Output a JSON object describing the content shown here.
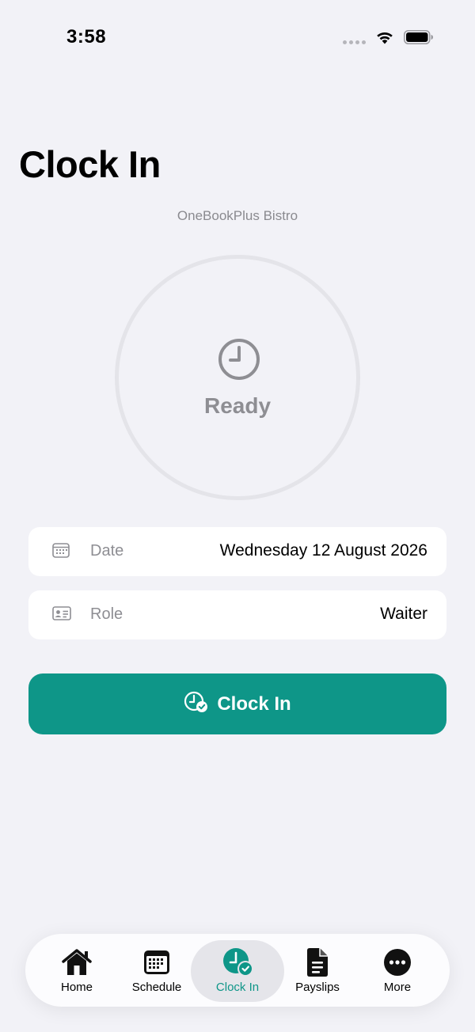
{
  "status_bar": {
    "time": "3:58",
    "icons": [
      "cellular-dots-icon",
      "wifi-icon",
      "battery-icon"
    ]
  },
  "header": {
    "title": "Clock In",
    "subtitle": "OneBookPlus Bistro"
  },
  "status_ring": {
    "icon": "clock-icon",
    "status": "Ready"
  },
  "details": {
    "date": {
      "icon": "calendar-icon",
      "label": "Date",
      "value": "Wednesday 12 August 2026"
    },
    "role": {
      "icon": "id-card-icon",
      "label": "Role",
      "value": "Waiter"
    }
  },
  "clock_in_button": {
    "icon": "clock-check-icon",
    "label": "Clock In"
  },
  "tab_bar": {
    "tabs": [
      {
        "label": "Home",
        "icon": "house-icon",
        "active": false
      },
      {
        "label": "Schedule",
        "icon": "calendar-icon",
        "active": false
      },
      {
        "label": "Clock In",
        "icon": "clock-check-icon",
        "active": true
      },
      {
        "label": "Payslips",
        "icon": "document-icon",
        "active": false
      },
      {
        "label": "More",
        "icon": "ellipsis-circle-icon",
        "active": false
      }
    ]
  },
  "colors": {
    "accent": "#0e9688",
    "background": "#f2f2f7",
    "card": "#ffffff",
    "secondary_text": "#8e8e93"
  }
}
